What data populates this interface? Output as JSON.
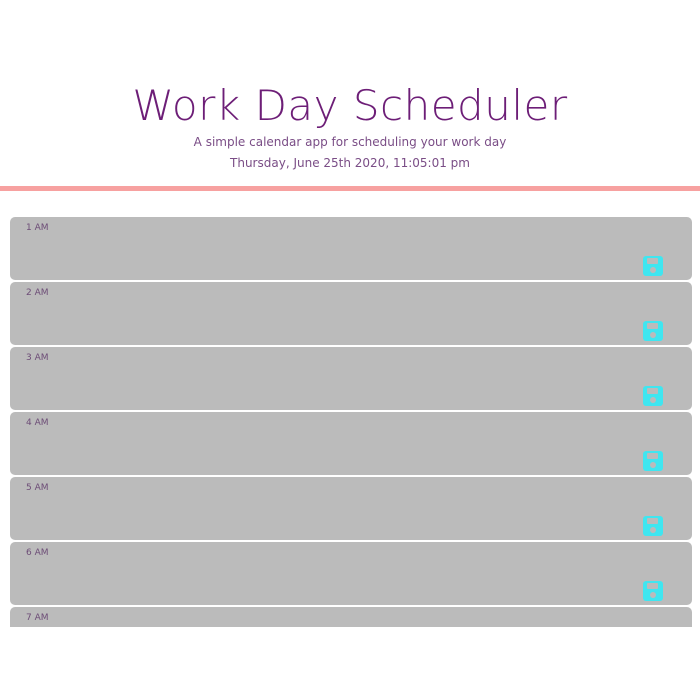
{
  "header": {
    "title": "Work Day Scheduler",
    "subtitle": "A simple calendar app for scheduling your work day",
    "current_day": "Thursday, June 25th 2020, 11:05:01 pm"
  },
  "colors": {
    "title": "#6d1e77",
    "divider": "#f7a1a0",
    "block_past": "#bbbbbb",
    "save_icon": "#3fe6f0"
  },
  "schedule": {
    "hours": [
      {
        "label": "1 AM",
        "text": "",
        "save_icon": "floppy-disk-icon"
      },
      {
        "label": "2 AM",
        "text": "",
        "save_icon": "floppy-disk-icon"
      },
      {
        "label": "3 AM",
        "text": "",
        "save_icon": "floppy-disk-icon"
      },
      {
        "label": "4 AM",
        "text": "",
        "save_icon": "floppy-disk-icon"
      },
      {
        "label": "5 AM",
        "text": "",
        "save_icon": "floppy-disk-icon"
      },
      {
        "label": "6 AM",
        "text": "",
        "save_icon": "floppy-disk-icon"
      },
      {
        "label": "7 AM",
        "text": "",
        "save_icon": "floppy-disk-icon"
      }
    ]
  }
}
